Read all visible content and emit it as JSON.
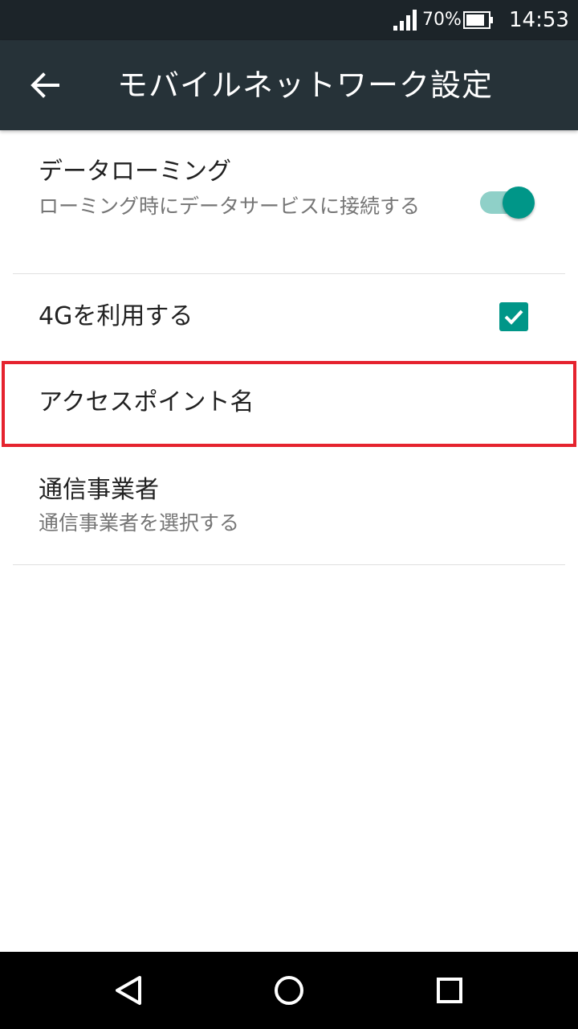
{
  "status_bar": {
    "battery_percent": "70%",
    "time": "14:53",
    "icons": [
      "signal-icon",
      "battery-icon"
    ]
  },
  "app_bar": {
    "title": "モバイルネットワーク設定",
    "back_icon": "arrow-left-icon"
  },
  "preferences": {
    "data_roaming": {
      "title": "データローミング",
      "summary": "ローミング時にデータサービスに接続する",
      "enabled": true
    },
    "use_4g": {
      "title": "4Gを利用する",
      "checked": true
    },
    "apn": {
      "title": "アクセスポイント名"
    },
    "carrier": {
      "title": "通信事業者",
      "summary": "通信事業者を選択する"
    }
  },
  "colors": {
    "accent": "#009688",
    "highlight": "#e5232e",
    "app_bar": "#263238",
    "status_bar": "#1c2429"
  },
  "nav_bar": {
    "icons": [
      "back-triangle-icon",
      "home-circle-icon",
      "recents-square-icon"
    ]
  }
}
